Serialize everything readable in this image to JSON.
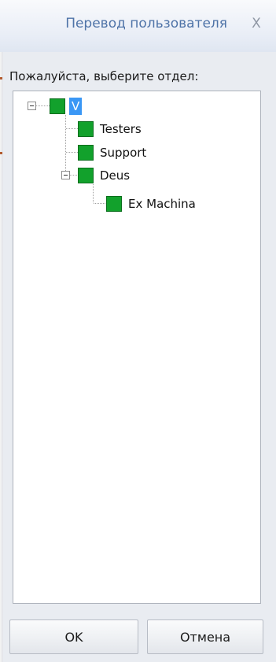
{
  "dialog": {
    "title": "Перевод пользователя",
    "close_label": "X",
    "prompt": "Пожалуйста, выберите отдел:"
  },
  "tree": {
    "root": {
      "label": "V",
      "icon": "department-icon",
      "expanded": true,
      "selected": true
    },
    "children": [
      {
        "label": "Testers",
        "icon": "department-icon"
      },
      {
        "label": "Support",
        "icon": "department-icon"
      },
      {
        "label": "Deus",
        "icon": "department-icon",
        "expanded": true,
        "children": [
          {
            "label": "Ex Machina",
            "icon": "department-icon"
          }
        ]
      }
    ]
  },
  "buttons": {
    "ok_label": "OK",
    "cancel_label": "Отмена"
  },
  "colors": {
    "node_icon": "#12a12c",
    "selection": "#3a97f5",
    "title_text": "#4f74a8"
  }
}
